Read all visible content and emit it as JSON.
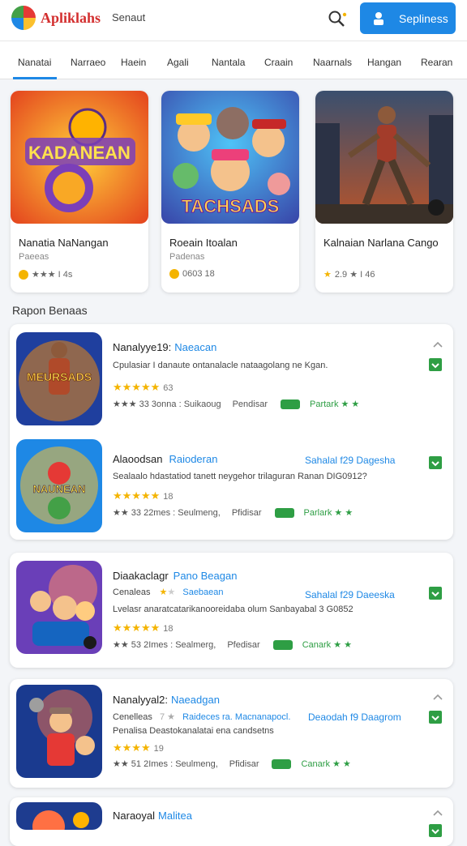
{
  "header": {
    "logo_text": "Apliklahs",
    "search_label": "Senaut",
    "primary_button": "Sepliness"
  },
  "tabs": [
    "Nanatai",
    "Narraeo",
    "Haein",
    "Agali",
    "Nantala",
    "Craain",
    "Naarnals",
    "Hangan",
    "Rearan"
  ],
  "featured": [
    {
      "art_text": "KADANEAN",
      "title": "Nanatia NaNangan",
      "subtitle": "Paeeas",
      "rating": "★★★ I 4s"
    },
    {
      "art_text": "TACHSADS",
      "title": "Roeain Itoalan",
      "subtitle": "Padenas",
      "rating": "0603 18"
    },
    {
      "art_text": "",
      "title": "Kalnaian Narlana Cango",
      "subtitle": "",
      "rating": "2.9 ★ I 46"
    }
  ],
  "section_title": "Rapon Benaas",
  "rows": [
    {
      "title": "Nanalyye19:",
      "title_accent": "Naeacan",
      "extra": "",
      "desc": "Cpulasiar I danaute ontanalacle nataagolang ne Kgan.",
      "stars": "★★★★★",
      "stars_num": "63",
      "meta_a": "★★★ 33 3onna : Suikaoug",
      "meta_b": "Pendisar",
      "meta_c": "Partark ★ ★",
      "art_text": "MEURSADS"
    },
    {
      "title": "Alaoodsan",
      "title_accent": "Raioderan",
      "extra": "Sahalal f29 Dagesha",
      "desc": "Sealaalo hdastatiod tanett neygehor trilaguran Ranan DIG0912?",
      "stars": "★★★★★",
      "stars_num": "18",
      "meta_a": "★★ 33 22mes : Seulmeng,",
      "meta_b": "Pfidisar",
      "meta_c": "Parlark ★ ★",
      "art_text": "NAUNEAN"
    },
    {
      "title": "Diaakaclagr",
      "title_accent": "Pano Beagan",
      "extra": "Sahalal f29 Daeeska",
      "desc": "Lvelasr anaratcatarikanooreidaba olum Sanbayabal 3 G0852",
      "stars": "★★★★★",
      "stars_num": "18",
      "meta_a": "★★ 53 2Imes : Sealmerg,",
      "meta_b": "Pfedisar",
      "meta_c": "Canark ★ ★",
      "art_text": ""
    },
    {
      "title": "Nanalyyal2:",
      "title_accent": "Naeadgan",
      "extra": "",
      "desc": "Penalisa Deastokanalatai ena candsetns",
      "stars": "★★★★",
      "stars_num": "19",
      "meta_a": "★★ 51 2Imes : Seulmeng,",
      "meta_b": "Pfidisar",
      "meta_c": "Canark ★ ★",
      "art_text": ""
    },
    {
      "title": "Naraoyal",
      "title_accent": "Malitea",
      "extra": "",
      "desc": "",
      "stars": "",
      "stars_num": "",
      "meta_a": "",
      "meta_b": "",
      "meta_c": "",
      "art_text": ""
    }
  ],
  "row_sub_lines": [
    {
      "left": "Cenaleas",
      "blue": "Saebaean"
    },
    {
      "left": "Cenelleas",
      "blue": "Raideces ra. Macnanapocl.",
      "extra": "Deaodah f9 Daagrom"
    }
  ],
  "colors": {
    "accent": "#1e88e5",
    "green": "#2e9e44",
    "star": "#f4b400",
    "logo": "#d32f2f"
  }
}
